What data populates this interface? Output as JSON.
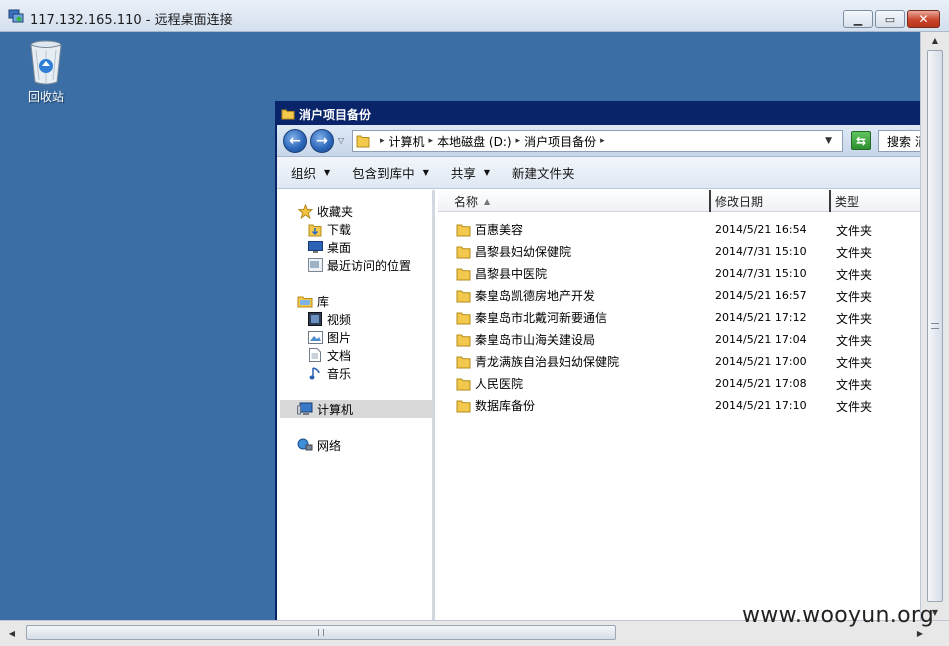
{
  "window": {
    "title": "117.132.165.110 - 远程桌面连接",
    "icon": "remote-desktop-icon"
  },
  "desktop": {
    "recycle_bin_label": "回收站",
    "background_color": "#3a6ea5"
  },
  "explorer": {
    "title": "消户项目备份",
    "breadcrumb": [
      "计算机",
      "本地磁盘 (D:)",
      "消户项目备份"
    ],
    "search_placeholder": "搜索 消",
    "toolbar": {
      "organize": "组织",
      "include_in_library": "包含到库中",
      "share": "共享",
      "new_folder": "新建文件夹"
    },
    "nav": {
      "favorites": "收藏夹",
      "downloads": "下载",
      "desktop": "桌面",
      "recent": "最近访问的位置",
      "libraries": "库",
      "videos": "视频",
      "pictures": "图片",
      "documents": "文档",
      "music": "音乐",
      "computer": "计算机",
      "network": "网络"
    },
    "columns": {
      "name": "名称",
      "date": "修改日期",
      "type": "类型"
    },
    "files": [
      {
        "name": "百惠美容",
        "date": "2014/5/21 16:54",
        "type": "文件夹"
      },
      {
        "name": "昌黎县妇幼保健院",
        "date": "2014/7/31 15:10",
        "type": "文件夹"
      },
      {
        "name": "昌黎县中医院",
        "date": "2014/7/31 15:10",
        "type": "文件夹"
      },
      {
        "name": "秦皇岛凯德房地产开发",
        "date": "2014/5/21 16:57",
        "type": "文件夹"
      },
      {
        "name": "秦皇岛市北戴河新要通信",
        "date": "2014/5/21 17:12",
        "type": "文件夹"
      },
      {
        "name": "秦皇岛市山海关建设局",
        "date": "2014/5/21 17:04",
        "type": "文件夹"
      },
      {
        "name": "青龙满族自治县妇幼保健院",
        "date": "2014/5/21 17:00",
        "type": "文件夹"
      },
      {
        "name": "人民医院",
        "date": "2014/5/21 17:08",
        "type": "文件夹"
      },
      {
        "name": "数据库备份",
        "date": "2014/5/21 17:10",
        "type": "文件夹"
      }
    ]
  },
  "watermark": "www.wooyun.org",
  "colors": {
    "explorer_title": "#0a246a",
    "folder": "#f2c94c",
    "close_button": "#c9452c"
  }
}
